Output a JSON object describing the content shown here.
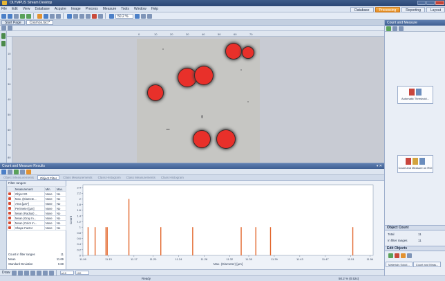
{
  "window": {
    "title": "OLYMPUS Stream Desktop"
  },
  "menu": [
    "File",
    "Edit",
    "View",
    "Database",
    "Acquire",
    "Image",
    "Process",
    "Measure",
    "Tools",
    "Window",
    "Help"
  ],
  "layouts": [
    {
      "label": "Database",
      "active": false
    },
    {
      "label": "Processing",
      "active": true
    },
    {
      "label": "Reporting",
      "active": false
    },
    {
      "label": "Layout",
      "active": false
    }
  ],
  "toolbar": {
    "zoom": "50.2 %"
  },
  "doc_tabs": [
    {
      "label": "Start Page",
      "active": false
    },
    {
      "label": "Cosmos.tscr*",
      "active": true
    }
  ],
  "ruler": {
    "ticks": [
      "0",
      "10",
      "20",
      "30",
      "40",
      "50",
      "60",
      "70"
    ]
  },
  "vruler": {
    "ticks": [
      "10",
      "20",
      "30",
      "40",
      "50",
      "60",
      "70",
      "80"
    ]
  },
  "right_panel": {
    "title": "Count and Measure",
    "auto_threshold": "Automatic Threshold...",
    "count_measure_roi": "Count and Measure on ROI",
    "object_count_title": "Object Count",
    "total_label": "Total",
    "total_value": "11",
    "in_filter_label": "In filter ranges",
    "in_filter_value": "11",
    "edit_objects_title": "Edit Objects",
    "bottom_tabs": [
      "Materials Soluti...",
      "Count and Meas..."
    ]
  },
  "results": {
    "title": "Count and Measure Results",
    "tabs": [
      {
        "label": "Object Measurements",
        "active": false
      },
      {
        "label": "Object Filter",
        "active": true
      },
      {
        "label": "Class Measurements",
        "active": false
      },
      {
        "label": "Class Histogram",
        "active": false
      },
      {
        "label": "Class Measurements",
        "active": false
      },
      {
        "label": "Class Histogram",
        "active": false
      }
    ],
    "filter_label": "Filter ranges:",
    "columns": [
      "Measurement",
      "Min.",
      "Max."
    ],
    "rows": [
      {
        "name": "Object ID",
        "min": "None",
        "max": "No"
      },
      {
        "name": "Max. (Diamete...",
        "min": "None",
        "max": "No"
      },
      {
        "name": "Area [µm²]",
        "min": "None",
        "max": "No"
      },
      {
        "name": "Perimeter [µm]",
        "min": "None",
        "max": "No"
      },
      {
        "name": "Mean (Radius) ...",
        "min": "None",
        "max": "No"
      },
      {
        "name": "Mean (Gray In...",
        "min": "None",
        "max": "No"
      },
      {
        "name": "Mean (Color In...",
        "min": "None",
        "max": "No"
      },
      {
        "name": "Shape Factor",
        "min": "None",
        "max": "No"
      }
    ],
    "stats": [
      {
        "label": "Count in filter ranges",
        "value": "11"
      },
      {
        "label": "Mean",
        "value": "11.69"
      },
      {
        "label": "Standard Deviation",
        "value": "0.68"
      }
    ]
  },
  "bottom_toolbar": {
    "label": "Draw",
    "width": "w10",
    "zoom": "100"
  },
  "status": {
    "ready": "Ready",
    "zoom": "50.2 % (0.52x)"
  },
  "colors": {
    "accent": "#e38b21",
    "particle": "#e8302a",
    "panel_header": "#4f6fa2"
  },
  "chart_data": {
    "type": "bar",
    "xlabel": "Max. (Diameter) [µm]",
    "ylabel": "Count",
    "x_ticks": [
      "11.09",
      "11.13",
      "11.17",
      "11.20",
      "11.24",
      "11.28",
      "11.32",
      "11.35",
      "11.39",
      "11.43",
      "11.47",
      "11.51",
      "11.54"
    ],
    "xlim": [
      11.09,
      11.545
    ],
    "ylim": [
      0,
      2.5
    ],
    "y_ticks": [
      "0",
      "0.2",
      "0.4",
      "0.6",
      "0.8",
      "1",
      "1.2",
      "1.4",
      "1.6",
      "1.8",
      "2",
      "2.2",
      "2.4"
    ],
    "bars": [
      {
        "x": 11.098,
        "count": 1
      },
      {
        "x": 11.109,
        "count": 1
      },
      {
        "x": 11.126,
        "count": 1
      },
      {
        "x": 11.128,
        "count": 1
      },
      {
        "x": 11.162,
        "count": 2
      },
      {
        "x": 11.212,
        "count": 1
      },
      {
        "x": 11.262,
        "count": 1
      },
      {
        "x": 11.338,
        "count": 1
      },
      {
        "x": 11.361,
        "count": 1
      },
      {
        "x": 11.384,
        "count": 1
      },
      {
        "x": 11.513,
        "count": 1
      }
    ],
    "grid": false
  }
}
